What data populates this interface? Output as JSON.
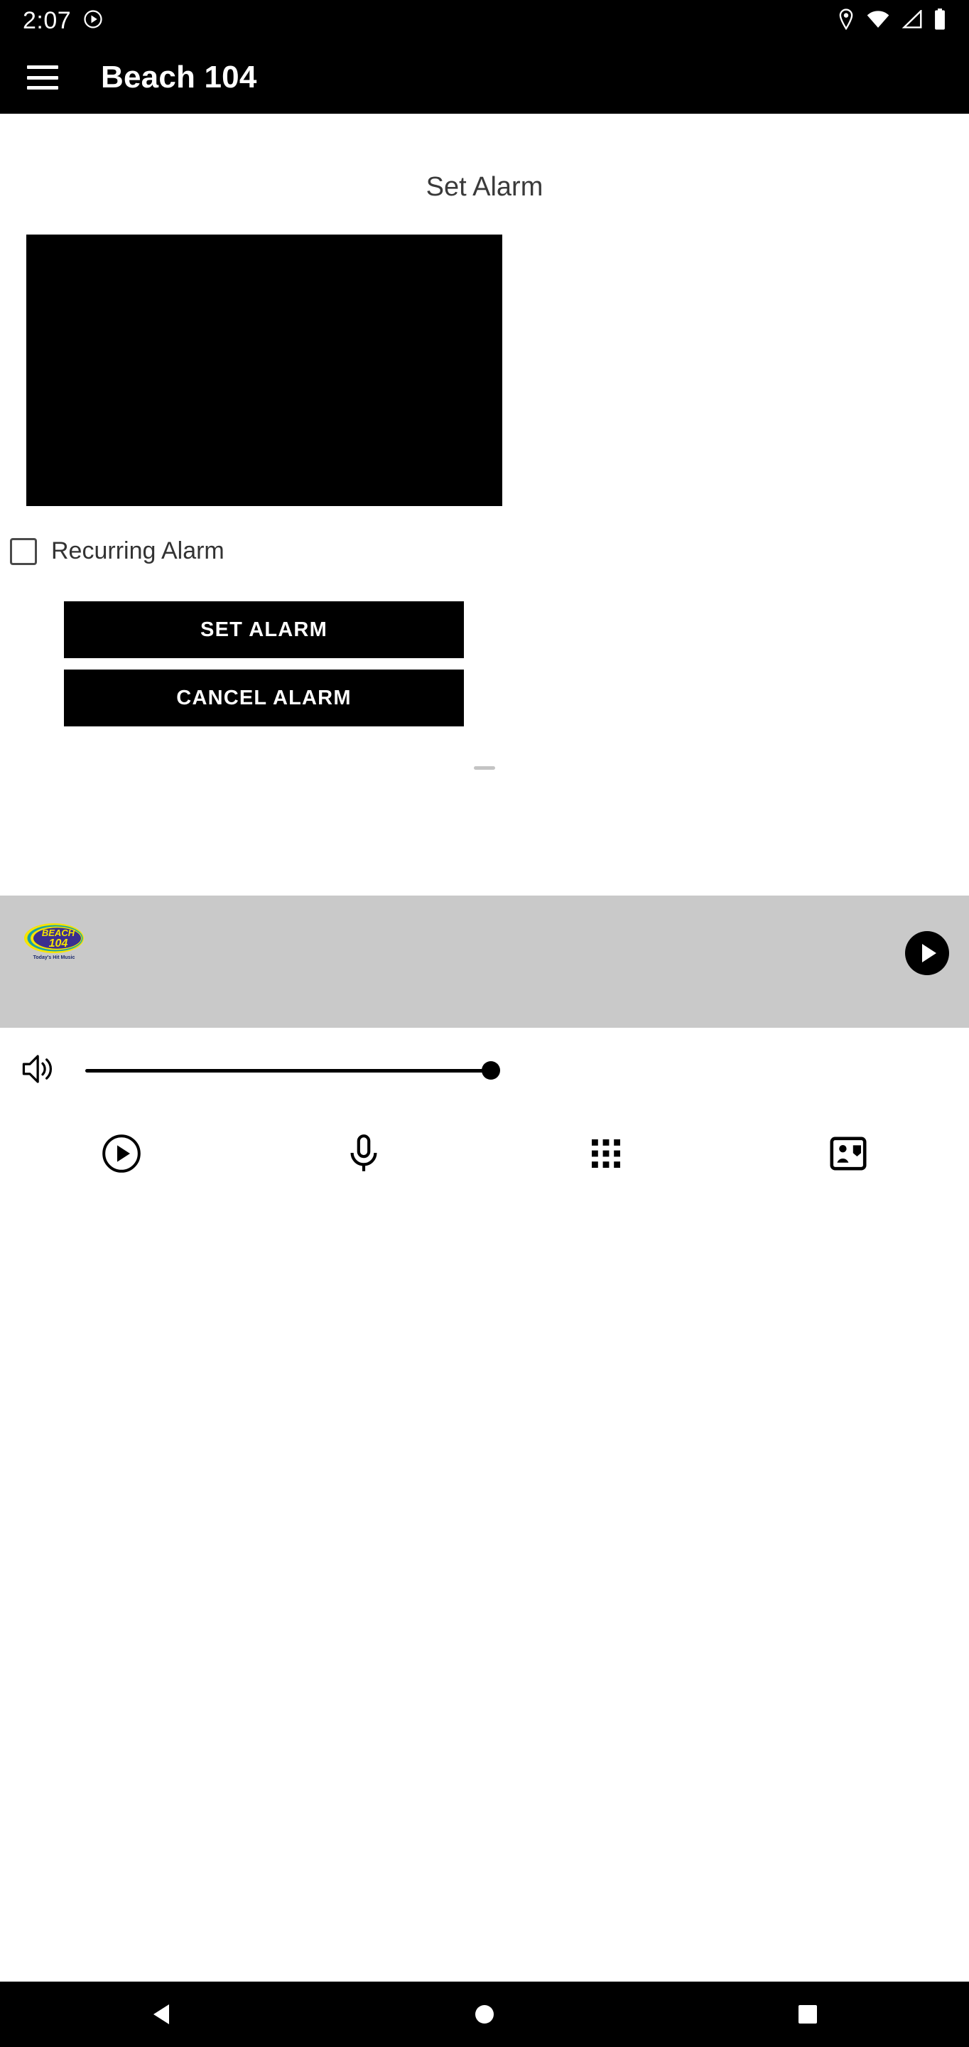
{
  "status_bar": {
    "time": "2:07",
    "icons": [
      "play-circle-icon",
      "location-pin-icon",
      "wifi-icon",
      "cell-signal-icon",
      "battery-icon"
    ]
  },
  "app_bar": {
    "menu_icon": "hamburger-menu-icon",
    "title": "Beach 104"
  },
  "main": {
    "section_title": "Set Alarm",
    "time_picker_placeholder": "",
    "recurring": {
      "label": "Recurring Alarm",
      "checked": false
    },
    "buttons": {
      "set_alarm": "SET ALARM",
      "cancel_alarm": "CANCEL ALARM"
    }
  },
  "player": {
    "station_logo_text_top": "BEACH",
    "station_logo_text_mid": "104",
    "station_logo_tagline": "Today's Hit Music",
    "play_button": "play-icon",
    "background_color": "#c9c9c9"
  },
  "volume": {
    "icon": "speaker-volume-icon",
    "level_percent": 100
  },
  "toolbar": {
    "items": [
      {
        "name": "play-icon"
      },
      {
        "name": "microphone-icon"
      },
      {
        "name": "grid-apps-icon"
      },
      {
        "name": "contact-card-icon"
      }
    ]
  },
  "nav_bar": {
    "back": "back-triangle-icon",
    "home": "home-circle-icon",
    "recents": "recents-square-icon"
  },
  "colors": {
    "accent_black": "#000000",
    "panel_gray": "#c9c9c9",
    "logo_blue": "#3b2f8f",
    "logo_yellow": "#f5e400",
    "logo_teal": "#18a3a3"
  }
}
